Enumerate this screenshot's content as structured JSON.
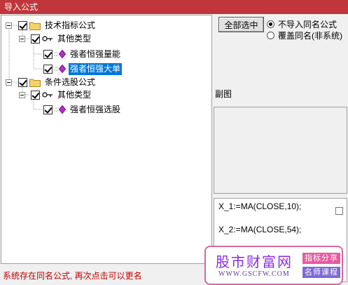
{
  "window": {
    "title": "导入公式"
  },
  "tree": {
    "nodes": [
      {
        "label": "技术指标公式",
        "icon": "folder-icon",
        "checked": true
      },
      {
        "label": "其他类型",
        "icon": "key-icon",
        "checked": true
      },
      {
        "label": "强者恒强量能",
        "icon": "formula-icon",
        "checked": true
      },
      {
        "label": "强者恒强大单",
        "icon": "formula-icon",
        "checked": true,
        "selected": true
      },
      {
        "label": "条件选股公式",
        "icon": "folder-icon",
        "checked": true
      },
      {
        "label": "其他类型",
        "icon": "key-icon",
        "checked": true
      },
      {
        "label": "强者恒强选股",
        "icon": "formula-icon",
        "checked": true
      }
    ]
  },
  "options": {
    "select_all_label": "全部选中",
    "radio_skip_label": "不导入同名公式",
    "radio_overwrite_label": "覆盖同名(非系统)",
    "selected": "skip"
  },
  "preview": {
    "subfig_label": "副图",
    "formula_lines": [
      "X_1:=MA(CLOSE,10);",
      "X_2:=MA(CLOSE,54);"
    ]
  },
  "status": {
    "message": "系统存在同名公式, 再次点击可以更名"
  },
  "watermark": {
    "title": "股市财富网",
    "url": "WWW.GSCFW.COM",
    "badge_top": "指标分享",
    "badge_bottom": "名师课程"
  },
  "colors": {
    "titlebar": "#c0363a",
    "selection": "#0078d7",
    "status_text": "#c00000",
    "watermark_border": "#d46aa0"
  }
}
